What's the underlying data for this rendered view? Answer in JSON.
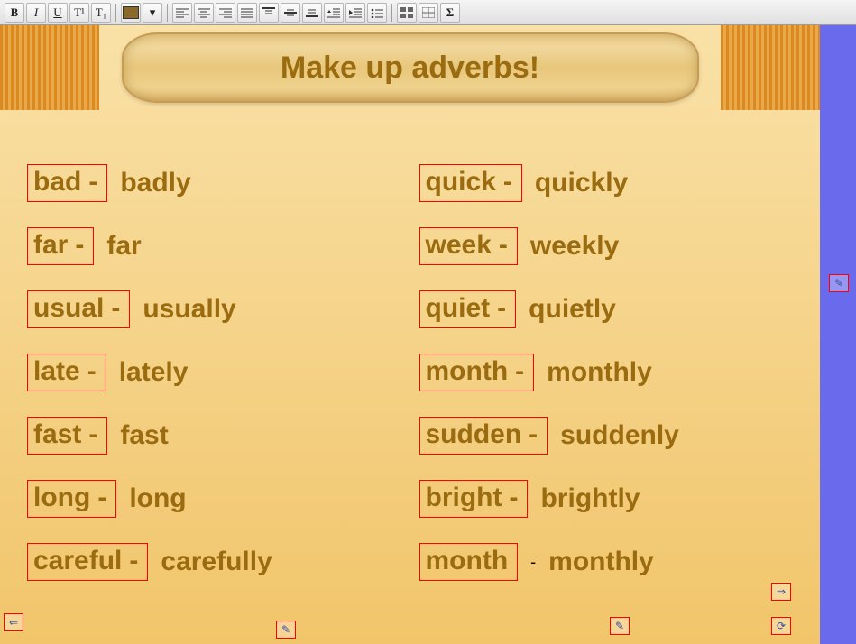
{
  "toolbar": {
    "bold": "B",
    "italic": "I",
    "underline": "U",
    "sup": "T¹",
    "sub": "T₁",
    "color_swatch": "#8a6a2a"
  },
  "banner": {
    "title": "Make up adverbs!"
  },
  "pairs": [
    {
      "word": "bad",
      "dash": "-",
      "adverb": "badly"
    },
    {
      "word": "quick",
      "dash": "-",
      "adverb": "quickly"
    },
    {
      "word": "far",
      "dash": "-",
      "adverb": "far"
    },
    {
      "word": "week",
      "dash": "-",
      "adverb": "weekly"
    },
    {
      "word": "usual",
      "dash": "-",
      "adverb": "usually"
    },
    {
      "word": "quiet",
      "dash": "-",
      "adverb": "quietly"
    },
    {
      "word": "late",
      "dash": "-",
      "adverb": "lately"
    },
    {
      "word": "month",
      "dash": "-",
      "adverb": "monthly"
    },
    {
      "word": "fast",
      "dash": "-",
      "adverb": "fast"
    },
    {
      "word": "sudden",
      "dash": "-",
      "adverb": "suddenly"
    },
    {
      "word": "long",
      "dash": "-",
      "adverb": "long"
    },
    {
      "word": "bright",
      "dash": "-",
      "adverb": "brightly"
    },
    {
      "word": "careful",
      "dash": "-",
      "adverb": "carefully"
    },
    {
      "word": "month",
      "dash": "-",
      "outer_dash": true,
      "adverb": "monthly"
    }
  ],
  "icons": {
    "back_arrow": "⇐",
    "pen": "✎",
    "forward_arrow": "⇒",
    "refresh": "⟳"
  }
}
